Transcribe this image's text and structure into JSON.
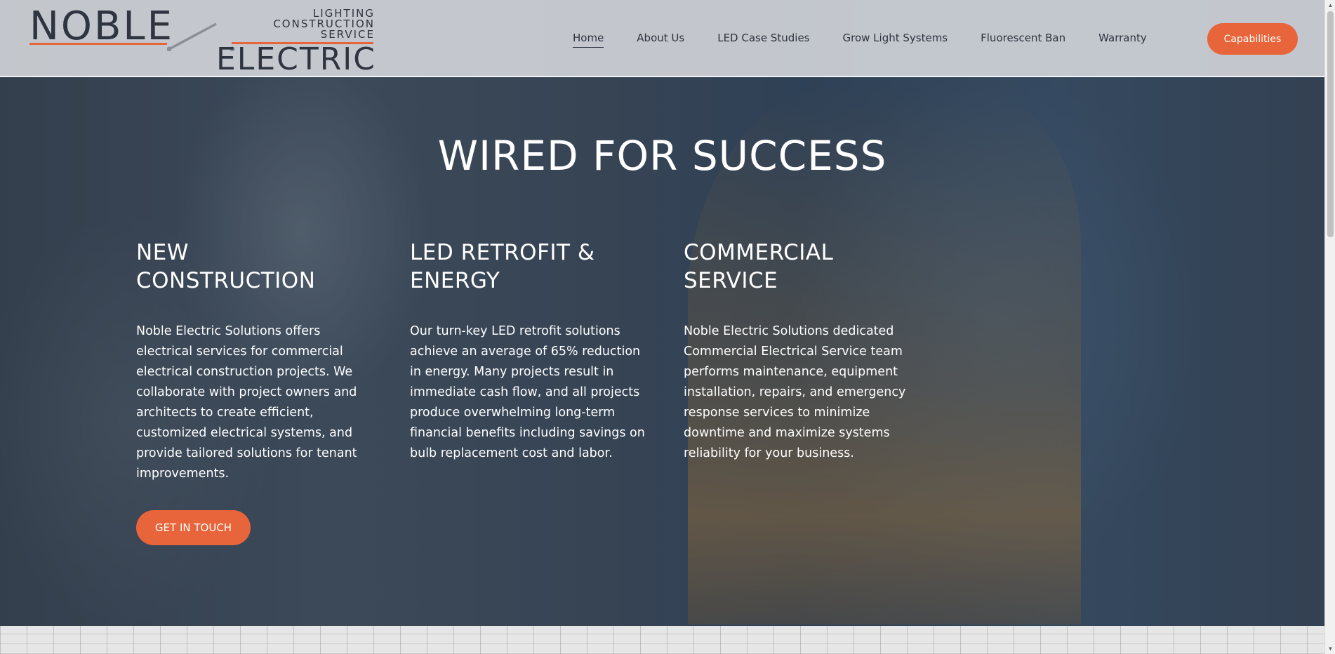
{
  "logo": {
    "name_top": "NOBLE",
    "name_bottom": "ELECTRIC",
    "tagline": [
      "LIGHTING",
      "CONSTRUCTION",
      "SERVICE"
    ]
  },
  "nav": {
    "items": [
      {
        "label": "Home",
        "active": true
      },
      {
        "label": "About Us"
      },
      {
        "label": "LED Case Studies"
      },
      {
        "label": "Grow Light Systems"
      },
      {
        "label": "Fluorescent Ban"
      },
      {
        "label": "Warranty"
      }
    ],
    "cta_label": "Capabilities"
  },
  "hero": {
    "title": "WIRED FOR SUCCESS",
    "columns": [
      {
        "heading": "NEW CONSTRUCTION",
        "text": "Noble Electric Solutions offers electrical services for commercial electrical  construction projects. We collaborate with project owners and architects to create efficient, customized electrical systems, and provide tailored solutions for tenant improvements."
      },
      {
        "heading": "LED RETROFIT & ENERGY",
        "text": "Our turn-key LED retrofit solutions achieve an average of 65% reduction in energy. Many projects result in immediate cash flow, and all projects produce overwhelming long-term financial benefits including savings on bulb replacement cost and labor."
      },
      {
        "heading": "COMMERCIAL SERVICE",
        "text": "Noble Electric Solutions dedicated Commercial Electrical Service team performs maintenance, equipment installation, repairs, and emergency response services to minimize downtime and maximize systems reliability for your business."
      }
    ],
    "cta_label": "GET IN TOUCH"
  },
  "colors": {
    "accent": "#e8643a",
    "header_bg": "#d7dade",
    "text_dark": "#2e3440",
    "text_light": "#ffffff"
  }
}
